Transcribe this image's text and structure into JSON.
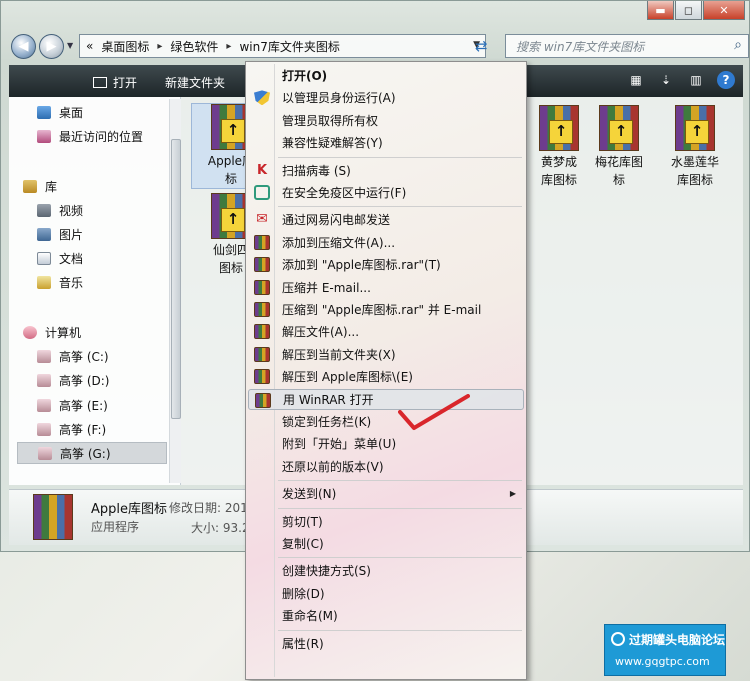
{
  "window": {
    "controls": [
      "▬",
      "◻",
      "✕"
    ]
  },
  "address_bar": {
    "prefix": "«",
    "crumbs": [
      "桌面图标",
      "绿色软件",
      "win7库文件夹图标"
    ],
    "separator": "▸",
    "dropdown": "▼",
    "refresh": "⇄"
  },
  "search": {
    "placeholder": "搜索 win7库文件夹图标",
    "icon": "search-icon"
  },
  "toolbar": {
    "open_label": "打开",
    "new_folder_label": "新建文件夹",
    "help": "?"
  },
  "nav_pane": {
    "favorites": [
      {
        "label": "桌面",
        "icon": "desktop-icon"
      },
      {
        "label": "最近访问的位置",
        "icon": "recent-places-icon"
      }
    ],
    "library_label": "库",
    "libraries": [
      {
        "label": "视频",
        "icon": "video-library-icon"
      },
      {
        "label": "图片",
        "icon": "pictures-library-icon"
      },
      {
        "label": "文档",
        "icon": "documents-library-icon"
      },
      {
        "label": "音乐",
        "icon": "music-library-icon"
      }
    ],
    "computer_label": "计算机",
    "drives": [
      {
        "label": "高筝 (C:)",
        "selected": false
      },
      {
        "label": "高筝 (D:)",
        "selected": false
      },
      {
        "label": "高筝 (E:)",
        "selected": false
      },
      {
        "label": "高筝 (F:)",
        "selected": false
      },
      {
        "label": "高筝 (G:)",
        "selected": true
      }
    ]
  },
  "files": [
    {
      "label": "Apple库\n标",
      "selected": true
    },
    {
      "label": "仙剑四\n图标",
      "selected": false
    },
    {
      "label": "黄梦成\n库图标",
      "selected": false
    },
    {
      "label": "梅花库图\n标",
      "selected": false
    },
    {
      "label": "水墨莲华\n库图标",
      "selected": false
    }
  ],
  "details": {
    "name": "Apple库图标",
    "type": "应用程序",
    "modified": "修改日期: 201",
    "size": "大小: 93.2"
  },
  "context_menu": [
    {
      "label": "打开(O)",
      "bold": true,
      "icon": ""
    },
    {
      "label": "以管理员身份运行(A)",
      "icon": "shield"
    },
    {
      "label": "管理员取得所有权",
      "icon": ""
    },
    {
      "label": "兼容性疑难解答(Y)",
      "icon": ""
    },
    {
      "sep": true
    },
    {
      "label": "扫描病毒 (S)",
      "icon": "scan"
    },
    {
      "label": "在安全免疫区中运行(F)",
      "icon": "safe"
    },
    {
      "sep": true
    },
    {
      "label": " 通过网易闪电邮发送",
      "icon": "mail"
    },
    {
      "label": "添加到压缩文件(A)...",
      "icon": "winrar"
    },
    {
      "label": "添加到 \"Apple库图标.rar\"(T)",
      "icon": "winrar"
    },
    {
      "label": "压缩并 E-mail...",
      "icon": "winrar"
    },
    {
      "label": "压缩到 \"Apple库图标.rar\" 并 E-mail",
      "icon": "winrar"
    },
    {
      "label": "解压文件(A)...",
      "icon": "winrar"
    },
    {
      "label": "解压到当前文件夹(X)",
      "icon": "winrar"
    },
    {
      "label": "解压到 Apple库图标\\(E)",
      "icon": "winrar"
    },
    {
      "label": "用 WinRAR 打开",
      "icon": "winrar",
      "highlight": true
    },
    {
      "label": "锁定到任务栏(K)",
      "icon": ""
    },
    {
      "label": "附到「开始」菜单(U)",
      "icon": ""
    },
    {
      "label": "还原以前的版本(V)",
      "icon": ""
    },
    {
      "sep": true
    },
    {
      "label": "发送到(N)",
      "icon": "",
      "submenu": true
    },
    {
      "sep": true
    },
    {
      "label": "剪切(T)",
      "icon": ""
    },
    {
      "label": "复制(C)",
      "icon": ""
    },
    {
      "sep": true
    },
    {
      "label": "创建快捷方式(S)",
      "icon": ""
    },
    {
      "label": "删除(D)",
      "icon": ""
    },
    {
      "label": "重命名(M)",
      "icon": ""
    },
    {
      "sep": true
    },
    {
      "label": "属性(R)",
      "icon": ""
    }
  ],
  "watermark": {
    "title": "过期罐头电脑论坛",
    "url": "www.gqgtpc.com"
  },
  "colors": {
    "toolbar": "#1d2528",
    "menu_highlight": "#e1e4e8",
    "check": "#d9262b",
    "watermark": "#1e9ad6"
  }
}
